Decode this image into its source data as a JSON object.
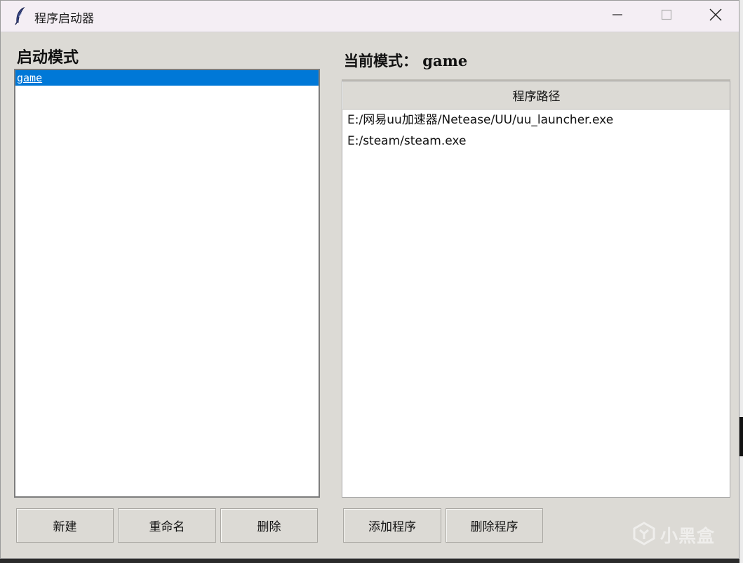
{
  "window": {
    "title": "程序启动器"
  },
  "left_panel": {
    "title": "启动模式",
    "modes": [
      {
        "label": "game",
        "selected": true
      }
    ]
  },
  "right_panel": {
    "title": "当前模式： game",
    "column_header": "程序路径",
    "rows": [
      "E:/网易uu加速器/Netease/UU/uu_launcher.exe",
      "E:/steam/steam.exe"
    ]
  },
  "buttons": {
    "new": "新建",
    "rename": "重命名",
    "delete": "删除",
    "add_program": "添加程序",
    "delete_program": "删除程序"
  },
  "watermark": {
    "text": "小黑盒"
  },
  "colors": {
    "selection": "#0078d7",
    "window_bg": "#dcdad5"
  }
}
